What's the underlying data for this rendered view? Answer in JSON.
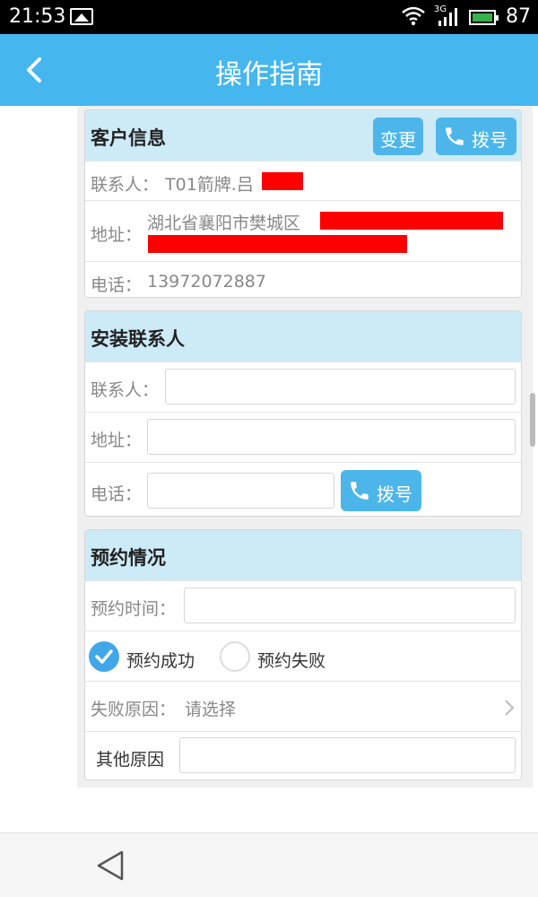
{
  "status_bar": {
    "time": "21:53",
    "network": "3G",
    "battery_level": "87"
  },
  "header": {
    "title": "操作指南"
  },
  "customer_info": {
    "title": "客户信息",
    "change_button": "变更",
    "dial_button": "拨号",
    "contact_label": "联系人：",
    "contact_value": "T01箭牌.吕",
    "address_label": "地址：",
    "address_value": "湖北省襄阳市樊城区",
    "phone_label": "电话：",
    "phone_value": "13972072887"
  },
  "install_contact": {
    "title": "安装联系人",
    "contact_label": "联系人：",
    "contact_value": "",
    "address_label": "地址：",
    "address_value": "",
    "phone_label": "电话：",
    "phone_value": "",
    "dial_button": "拨号"
  },
  "appointment": {
    "title": "预约情况",
    "time_label": "预约时间：",
    "time_value": "",
    "options": [
      {
        "label": "预约成功",
        "selected": true
      },
      {
        "label": "预约失败",
        "selected": false
      }
    ],
    "fail_reason_label": "失败原因：",
    "fail_reason_value": "请选择",
    "other_reason_label": "其他原因",
    "other_reason_value": ""
  },
  "colors": {
    "accent": "#45b6ee",
    "button": "#4cb6ea",
    "section_header": "#cdeaf7",
    "radio_selected": "#41a7e8"
  }
}
